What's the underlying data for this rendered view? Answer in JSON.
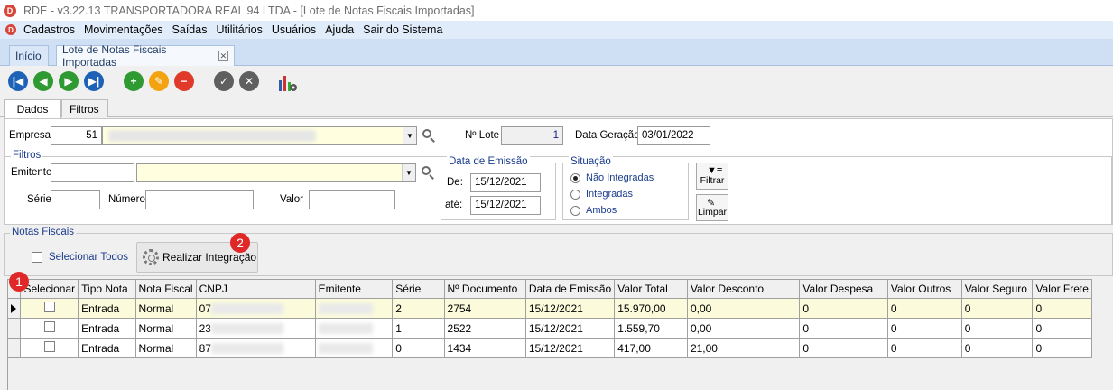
{
  "window": {
    "title": "RDE - v3.22.13    TRANSPORTADORA REAL 94 LTDA - [Lote de Notas Fiscais Importadas]",
    "app_icon": "rde-logo-icon"
  },
  "menu": {
    "items": [
      "Cadastros",
      "Movimentações",
      "Saídas",
      "Utilitários",
      "Usuários",
      "Ajuda",
      "Sair do Sistema"
    ]
  },
  "tabs": {
    "inicio": "Início",
    "lote": "Lote de Notas Fiscais Importadas"
  },
  "toolbar": {
    "icons": [
      "first-icon",
      "previous-icon",
      "next-icon",
      "last-icon",
      "add-icon",
      "edit-icon",
      "delete-icon",
      "confirm-icon",
      "cancel-icon",
      "report-chart-icon"
    ]
  },
  "detail_tabs": {
    "dados": "Dados",
    "filtros": "Filtros"
  },
  "header": {
    "empresa_label": "Empresa",
    "empresa_code": "51",
    "nlote_label": "Nº Lote",
    "nlote_value": "1",
    "data_geracao_label": "Data Geração",
    "data_geracao_value": "03/01/2022"
  },
  "filters": {
    "group_title": "Filtros",
    "emitente_label": "Emitente",
    "serie_label": "Série",
    "numero_label": "Número",
    "valor_label": "Valor",
    "emissao_title": "Data de Emissão",
    "de_label": "De:",
    "de_value": "15/12/2021",
    "ate_label": "até:",
    "ate_value": "15/12/2021",
    "situacao_title": "Situação",
    "situacao_options": [
      "Não Integradas",
      "Integradas",
      "Ambos"
    ],
    "situacao_selected": "Não Integradas",
    "filtrar_label": "Filtrar",
    "limpar_label": "Limpar"
  },
  "notas": {
    "group_title": "Notas Fiscais",
    "selecionar_todos": "Selecionar Todos",
    "realizar_button": "Realizar Integração",
    "marker_1": "1",
    "marker_2": "2"
  },
  "grid": {
    "columns": [
      "Selecionar",
      "Tipo Nota",
      "Nota Fiscal",
      "CNPJ",
      "Emitente",
      "Série",
      "Nº Documento",
      "Data de Emissão",
      "Valor Total",
      "Valor Desconto",
      "Valor Despesa",
      "Valor Outros",
      "Valor Seguro",
      "Valor Frete"
    ],
    "rows": [
      {
        "tipo": "Entrada",
        "nota": "Normal",
        "cnpj": "07",
        "serie": "2",
        "documento": "2754",
        "emissao": "15/12/2021",
        "total": "15.970,00",
        "desconto": "0,00",
        "despesa": "0",
        "outros": "0",
        "seguro": "0",
        "frete": "0"
      },
      {
        "tipo": "Entrada",
        "nota": "Normal",
        "cnpj": "23",
        "serie": "1",
        "documento": "2522",
        "emissao": "15/12/2021",
        "total": "1.559,70",
        "desconto": "0,00",
        "despesa": "0",
        "outros": "0",
        "seguro": "0",
        "frete": "0"
      },
      {
        "tipo": "Entrada",
        "nota": "Normal",
        "cnpj": "87",
        "serie": "0",
        "documento": "1434",
        "emissao": "15/12/2021",
        "total": "417,00",
        "desconto": "21,00",
        "despesa": "0",
        "outros": "0",
        "seguro": "0",
        "frete": "0"
      }
    ]
  },
  "colors": {
    "marker": "#e02828",
    "selected_row": "#fbfbdc",
    "combo_yellow": "#ffffe0",
    "label_blue": "#1a3c8c"
  }
}
